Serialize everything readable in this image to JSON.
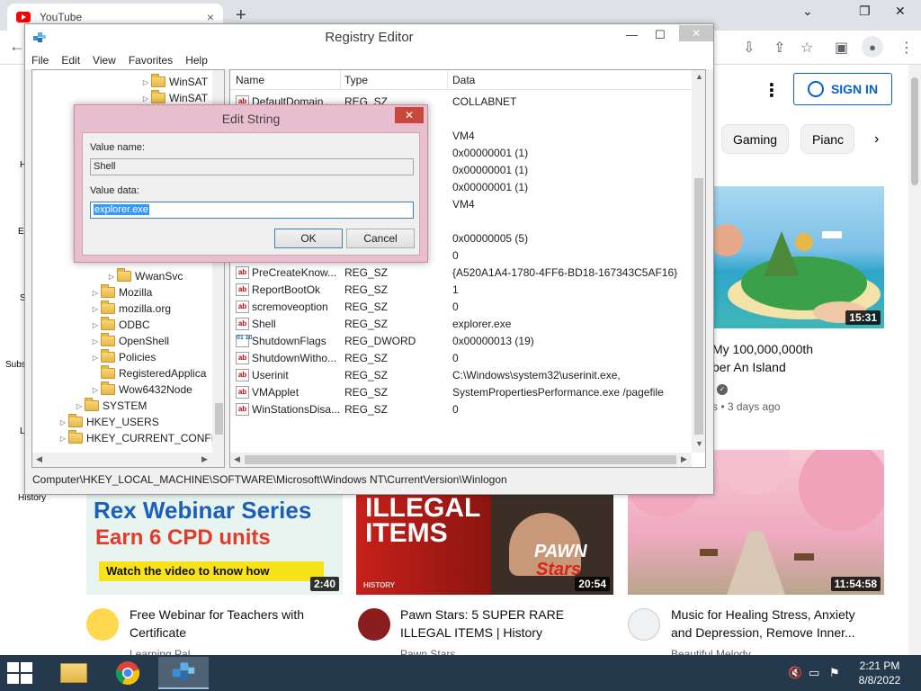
{
  "browser": {
    "tab_title": "YouTube",
    "tab_close": "×",
    "new_tab": "+",
    "back": "←",
    "min": "⌄",
    "restore": "❐",
    "close": "✕"
  },
  "youtube": {
    "signin": "SIGN IN",
    "chips": [
      "Gaming",
      "Pianc"
    ],
    "sidebar": [
      "H",
      "E",
      "S",
      "Subs",
      "L",
      "History"
    ],
    "videos": [
      {
        "title_line1": "My 100,000,000th",
        "title_line2": "ber An Island",
        "meta": "s • 3 days ago",
        "duration": "15:31"
      },
      {
        "title_line1": "Free Webinar for Teachers with",
        "title_line2": "Certificate",
        "meta": "Learning Pal",
        "duration": "2:40",
        "thumb_line1": "Rex Webinar Series",
        "thumb_line2": "Earn 6 CPD units",
        "thumb_line3": "Watch the video to know how"
      },
      {
        "title_line1": "Pawn Stars: 5 SUPER RARE",
        "title_line2": "ILLEGAL ITEMS | History",
        "meta": "Pawn Stars",
        "duration": "20:54",
        "thumb_line1": "ILLEGAL",
        "thumb_line2": "ITEMS",
        "thumb_line3": "PAWN",
        "thumb_line4": "Stars",
        "thumb_line5": "HISTORY"
      },
      {
        "title_line1": "Music for Healing Stress, Anxiety",
        "title_line2": "and Depression, Remove Inner...",
        "meta": "Beautiful Melody",
        "duration": "11:54:58"
      }
    ]
  },
  "regedit": {
    "title": "Registry Editor",
    "menu": [
      "File",
      "Edit",
      "View",
      "Favorites",
      "Help"
    ],
    "tree": [
      {
        "label": "WinSAT",
        "indent": 7,
        "arrow": "▷"
      },
      {
        "label": "WinSAT",
        "indent": 7,
        "arrow": "▷"
      },
      {
        "label": "WwanSvc",
        "indent": 5,
        "arrow": "▷"
      },
      {
        "label": "Mozilla",
        "indent": 4,
        "arrow": "▷"
      },
      {
        "label": "mozilla.org",
        "indent": 4,
        "arrow": "▷"
      },
      {
        "label": "ODBC",
        "indent": 4,
        "arrow": "▷"
      },
      {
        "label": "OpenShell",
        "indent": 4,
        "arrow": "▷"
      },
      {
        "label": "Policies",
        "indent": 4,
        "arrow": "▷"
      },
      {
        "label": "RegisteredApplica",
        "indent": 4,
        "arrow": ""
      },
      {
        "label": "Wow6432Node",
        "indent": 4,
        "arrow": "▷"
      },
      {
        "label": "SYSTEM",
        "indent": 3,
        "arrow": "▷"
      },
      {
        "label": "HKEY_USERS",
        "indent": 2,
        "arrow": "▷"
      },
      {
        "label": "HKEY_CURRENT_CONFIG",
        "indent": 2,
        "arrow": "▷"
      }
    ],
    "columns": [
      "Name",
      "Type",
      "Data"
    ],
    "rows": [
      {
        "name": "DefaultDomain...",
        "type": "REG_SZ",
        "data": "COLLABNET",
        "icon": "ab"
      },
      {
        "name": "",
        "type": "",
        "data": "",
        "icon": ""
      },
      {
        "name": "",
        "type": "",
        "data": "VM4",
        "icon": ""
      },
      {
        "name": "",
        "type": "",
        "data": "0x00000001 (1)",
        "icon": ""
      },
      {
        "name": "",
        "type": "",
        "data": "0x00000001 (1)",
        "icon": ""
      },
      {
        "name": "",
        "type": "",
        "data": "0x00000001 (1)",
        "icon": ""
      },
      {
        "name": "",
        "type": "",
        "data": "VM4",
        "icon": ""
      },
      {
        "name": "",
        "type": "",
        "data": "",
        "icon": ""
      },
      {
        "name": "",
        "type": "",
        "data": "0x00000005 (5)",
        "icon": ""
      },
      {
        "name": "PowerdownAfte...",
        "type": "REG_SZ",
        "data": "0",
        "icon": "ab"
      },
      {
        "name": "PreCreateKnow...",
        "type": "REG_SZ",
        "data": "{A520A1A4-1780-4FF6-BD18-167343C5AF16}",
        "icon": "ab"
      },
      {
        "name": "ReportBootOk",
        "type": "REG_SZ",
        "data": "1",
        "icon": "ab"
      },
      {
        "name": "scremoveoption",
        "type": "REG_SZ",
        "data": "0",
        "icon": "ab"
      },
      {
        "name": "Shell",
        "type": "REG_SZ",
        "data": "explorer.exe",
        "icon": "ab"
      },
      {
        "name": "ShutdownFlags",
        "type": "REG_DWORD",
        "data": "0x00000013 (19)",
        "icon": "bin"
      },
      {
        "name": "ShutdownWitho...",
        "type": "REG_SZ",
        "data": "0",
        "icon": "ab"
      },
      {
        "name": "Userinit",
        "type": "REG_SZ",
        "data": "C:\\Windows\\system32\\userinit.exe,",
        "icon": "ab"
      },
      {
        "name": "VMApplet",
        "type": "REG_SZ",
        "data": "SystemPropertiesPerformance.exe /pagefile",
        "icon": "ab"
      },
      {
        "name": "WinStationsDisa...",
        "type": "REG_SZ",
        "data": "0",
        "icon": "ab"
      }
    ],
    "status": "Computer\\HKEY_LOCAL_MACHINE\\SOFTWARE\\Microsoft\\Windows NT\\CurrentVersion\\Winlogon"
  },
  "edit_string": {
    "title": "Edit String",
    "value_name_label": "Value name:",
    "value_name": "Shell",
    "value_data_label": "Value data:",
    "value_data": "explorer.exe",
    "ok": "OK",
    "cancel": "Cancel",
    "close": "✕"
  },
  "taskbar": {
    "time": "2:21 PM",
    "date": "8/8/2022"
  }
}
